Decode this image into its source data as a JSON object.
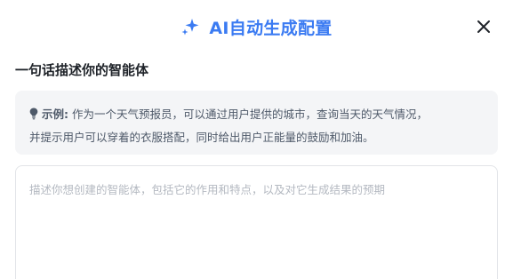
{
  "dialog": {
    "title": "AI自动生成配置",
    "icons": {
      "title": "sparkle-icon",
      "close": "close-icon",
      "example": "lightbulb-icon"
    },
    "colors": {
      "accent": "#3b7bf2",
      "text": "#1f2329",
      "muted_text": "#4e5969",
      "placeholder": "#b4b9c1",
      "example_bg": "#f4f5f7"
    }
  },
  "section": {
    "label": "一句话描述你的智能体"
  },
  "example": {
    "prefix": "示例:",
    "line1": "作为一个天气预报员，可以通过用户提供的城市，查询当天的天气情况，",
    "line2": "并提示用户可以穿着的衣服搭配，同时给出用户正能量的鼓励和加油。"
  },
  "description_input": {
    "placeholder": "描述你想创建的智能体，包括它的作用和特点，以及对它生成结果的预期",
    "value": ""
  }
}
